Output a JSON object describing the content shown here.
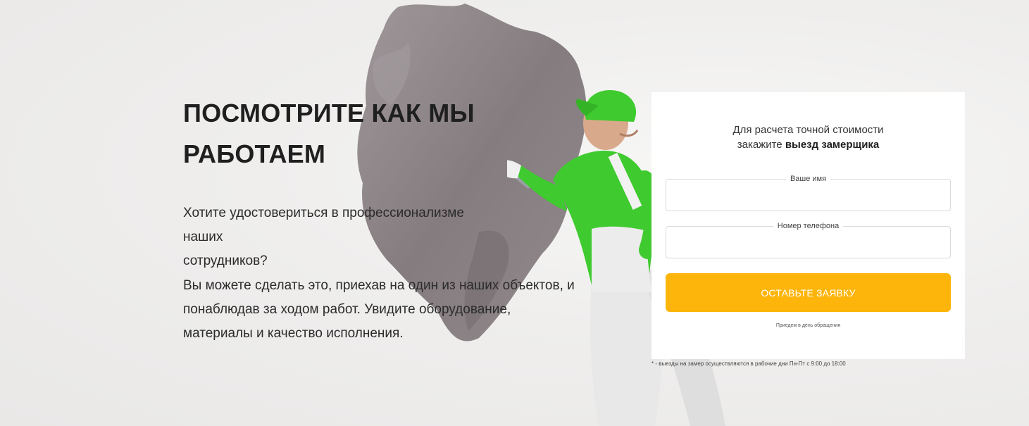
{
  "section": {
    "heading_line1": "ПОСМОТРИТЕ КАК МЫ",
    "heading_line2": "РАБОТАЕМ",
    "paragraph1_line1": "Хотите удостовериться в профессионализме наших",
    "paragraph1_line2": "сотрудников?",
    "paragraph2_line1": "Вы можете сделать это, приехав на один из наших объектов, и",
    "paragraph2_line2": "понаблюдав за ходом работ. Увидите оборудование,",
    "paragraph2_line3": "материалы и качество исполнения."
  },
  "form": {
    "title_line1": "Для расчета точной стоимости",
    "title_line2_prefix": "закажите ",
    "title_line2_bold": "выезд замерщика",
    "name_label": "Ваше имя",
    "name_value": "",
    "phone_label": "Номер телефона",
    "phone_value": "",
    "submit_label": "ОСТАВЬТЕ ЗАЯВКУ",
    "note": "Приедем в день обращения"
  },
  "footnote": "* - выезды на замер осуществляются в рабочие дни Пн-Пт с 9:00 до 18:00",
  "colors": {
    "accent": "#fdb50b",
    "worker_green": "#3fca2f",
    "paint_gray": "#8a8184"
  },
  "icons": {
    "paint_roller": "paint-roller-icon"
  }
}
